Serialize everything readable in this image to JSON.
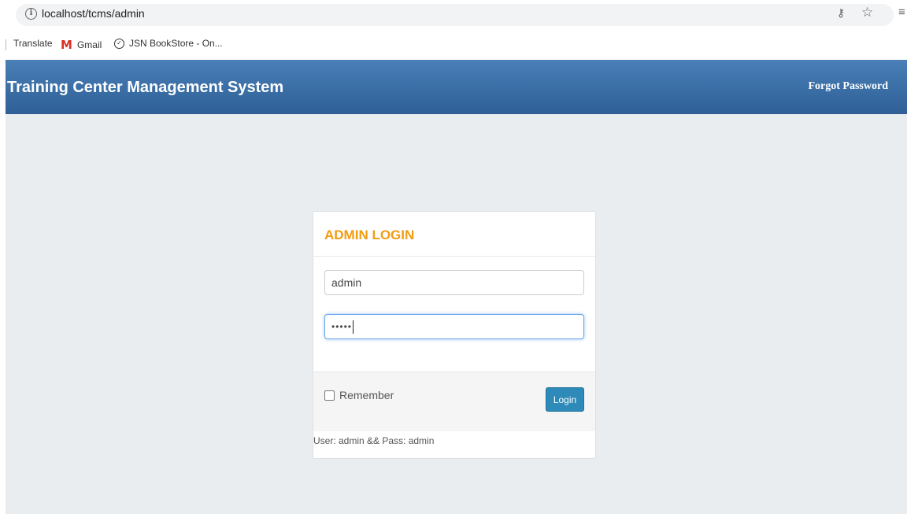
{
  "browser": {
    "url": "localhost/tcms/admin",
    "bookmarks": [
      {
        "label": "Translate"
      },
      {
        "label": "Gmail"
      },
      {
        "label": "JSN BookStore - On..."
      }
    ]
  },
  "header": {
    "title": "Training Center Management System",
    "forgot_password": "Forgot Password"
  },
  "login": {
    "title": "ADMIN LOGIN",
    "username_value": "admin",
    "password_masked": "•••••",
    "remember_label": "Remember",
    "remember_checked": false,
    "login_button": "Login",
    "hint": "User: admin && Pass: admin"
  },
  "colors": {
    "header_bg": "#3a6ea5",
    "title_accent": "#f39c12",
    "button_bg": "#2e8ab8",
    "page_bg": "#eaedf0"
  }
}
